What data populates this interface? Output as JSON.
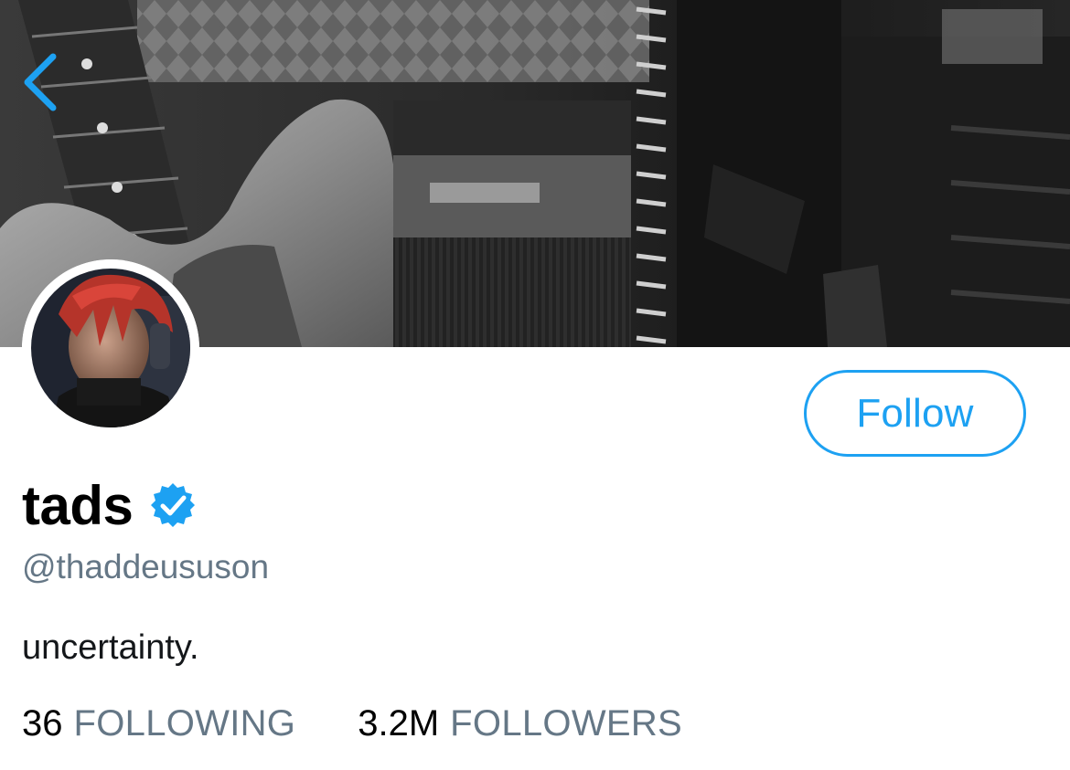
{
  "header": {
    "banner_icon": "header-photo",
    "back_icon": "chevron-left-icon"
  },
  "profile": {
    "display_name": "tads",
    "verified_icon": "verified-badge-icon",
    "handle": "@thaddeususon",
    "bio": "uncertainty.",
    "follow_label": "Follow",
    "stats": [
      {
        "count": "36",
        "label": "FOLLOWING"
      },
      {
        "count": "3.2M",
        "label": "FOLLOWERS"
      }
    ]
  },
  "colors": {
    "accent": "#1da1f2",
    "secondary_text": "#657786",
    "primary_text": "#000000",
    "background": "#ffffff"
  }
}
